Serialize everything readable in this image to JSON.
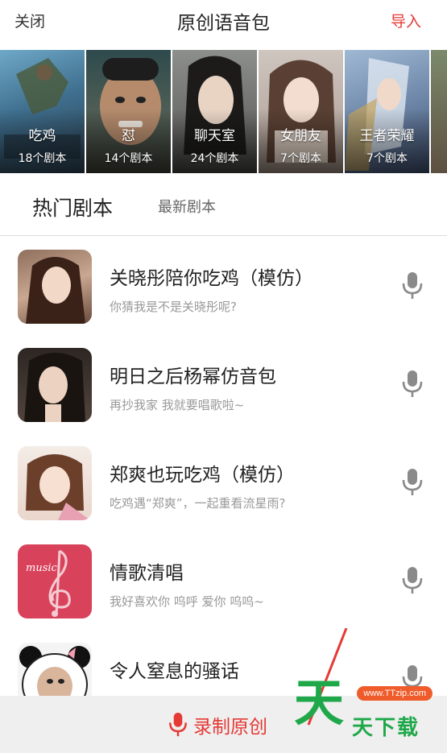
{
  "header": {
    "close": "关闭",
    "title": "原创语音包",
    "import": "导入"
  },
  "categories": [
    {
      "name": "吃鸡",
      "count": "18个剧本"
    },
    {
      "name": "怼",
      "count": "14个剧本"
    },
    {
      "name": "聊天室",
      "count": "24个剧本"
    },
    {
      "name": "女朋友",
      "count": "7个剧本"
    },
    {
      "name": "王者荣耀",
      "count": "7个剧本"
    }
  ],
  "tabs": {
    "hot": "热门剧本",
    "latest": "最新剧本"
  },
  "scripts": [
    {
      "title": "关晓彤陪你吃鸡（模仿）",
      "subtitle": "你猜我是不是关晓彤呢?"
    },
    {
      "title": "明日之后杨幂仿音包",
      "subtitle": "再抄我家 我就要唱歌啦~"
    },
    {
      "title": "郑爽也玩吃鸡（模仿）",
      "subtitle": "吃鸡遇“郑爽”，一起重看流星雨?"
    },
    {
      "title": "情歌清唱",
      "subtitle": "我好喜欢你 呜呼 爱你 呜呜~",
      "thumb_text": "music"
    },
    {
      "title": "令人窒息的骚话",
      "subtitle": ""
    }
  ],
  "bottom": {
    "record_label": "录制原创"
  },
  "watermark": {
    "url": "www.TTzip.com",
    "big": "天",
    "small": "天下载"
  },
  "colors": {
    "accent": "#e53935",
    "watermark_green": "#1fa84a",
    "watermark_orange": "#ef5b2a"
  }
}
